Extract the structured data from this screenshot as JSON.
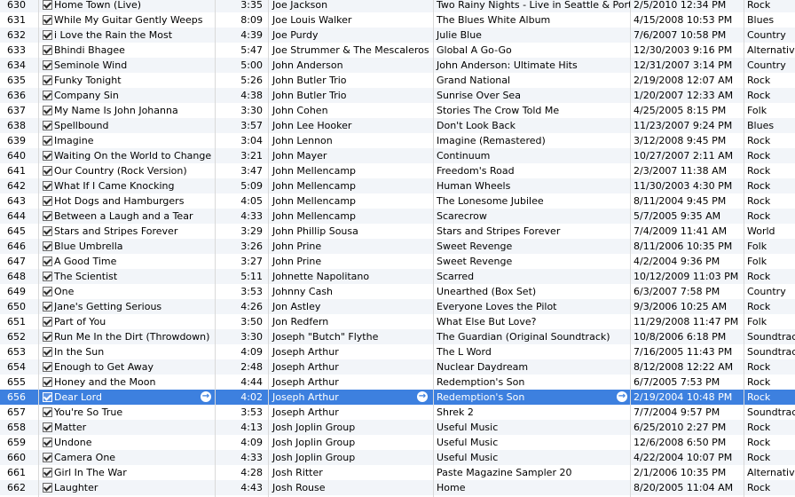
{
  "tracks": [
    {
      "num": "630",
      "name": "Home Town (Live)",
      "time": "3:35",
      "artist": "Joe Jackson",
      "album": "Two Rainy Nights - Live in Seattle & Portla...",
      "date_added": "2/5/2010 12:34 PM",
      "genre": "Rock"
    },
    {
      "num": "631",
      "name": "While My Guitar Gently Weeps",
      "time": "8:09",
      "artist": "Joe Louis Walker",
      "album": "The Blues White Album",
      "date_added": "4/15/2008 10:53 PM",
      "genre": "Blues"
    },
    {
      "num": "632",
      "name": "i Love the Rain the Most",
      "time": "4:39",
      "artist": "Joe Purdy",
      "album": "Julie Blue",
      "date_added": "7/6/2007 10:58 PM",
      "genre": "Country"
    },
    {
      "num": "633",
      "name": "Bhindi Bhagee",
      "time": "5:47",
      "artist": "Joe Strummer & The Mescaleros",
      "album": "Global A Go-Go",
      "date_added": "12/30/2003 9:16 PM",
      "genre": "Alternative"
    },
    {
      "num": "634",
      "name": "Seminole Wind",
      "time": "5:00",
      "artist": "John Anderson",
      "album": "John Anderson: Ultimate Hits",
      "date_added": "12/31/2007 3:14 PM",
      "genre": "Country"
    },
    {
      "num": "635",
      "name": "Funky Tonight",
      "time": "5:26",
      "artist": "John Butler Trio",
      "album": "Grand National",
      "date_added": "2/19/2008 12:07 AM",
      "genre": "Rock"
    },
    {
      "num": "636",
      "name": "Company Sin",
      "time": "4:38",
      "artist": "John Butler Trio",
      "album": "Sunrise Over Sea",
      "date_added": "1/20/2007 12:33 AM",
      "genre": "Rock"
    },
    {
      "num": "637",
      "name": "My Name Is John Johanna",
      "time": "3:30",
      "artist": "John Cohen",
      "album": "Stories The Crow Told Me",
      "date_added": "4/25/2005 8:15 PM",
      "genre": "Folk"
    },
    {
      "num": "638",
      "name": "Spellbound",
      "time": "3:57",
      "artist": "John Lee Hooker",
      "album": "Don't Look Back",
      "date_added": "11/23/2007 9:24 PM",
      "genre": "Blues"
    },
    {
      "num": "639",
      "name": "Imagine",
      "time": "3:04",
      "artist": "John Lennon",
      "album": "Imagine (Remastered)",
      "date_added": "3/12/2008 9:45 PM",
      "genre": "Rock"
    },
    {
      "num": "640",
      "name": "Waiting On the World to Change",
      "time": "3:21",
      "artist": "John Mayer",
      "album": "Continuum",
      "date_added": "10/27/2007 2:11 AM",
      "genre": "Rock"
    },
    {
      "num": "641",
      "name": "Our Country (Rock Version)",
      "time": "3:47",
      "artist": "John Mellencamp",
      "album": "Freedom's Road",
      "date_added": "2/3/2007 11:38 AM",
      "genre": "Rock"
    },
    {
      "num": "642",
      "name": "What If I Came Knocking",
      "time": "5:09",
      "artist": "John Mellencamp",
      "album": "Human Wheels",
      "date_added": "11/30/2003 4:30 PM",
      "genre": "Rock"
    },
    {
      "num": "643",
      "name": "Hot Dogs and Hamburgers",
      "time": "4:05",
      "artist": "John Mellencamp",
      "album": "The Lonesome Jubilee",
      "date_added": "8/11/2004 9:45 PM",
      "genre": "Rock"
    },
    {
      "num": "644",
      "name": "Between a Laugh and a Tear",
      "time": "4:33",
      "artist": "John Mellencamp",
      "album": "Scarecrow",
      "date_added": "5/7/2005 9:35 AM",
      "genre": "Rock"
    },
    {
      "num": "645",
      "name": "Stars and Stripes Forever",
      "time": "3:29",
      "artist": "John Phillip Sousa",
      "album": "Stars and Stripes Forever",
      "date_added": "7/4/2009 11:41 AM",
      "genre": "World"
    },
    {
      "num": "646",
      "name": "Blue Umbrella",
      "time": "3:26",
      "artist": "John Prine",
      "album": "Sweet Revenge",
      "date_added": "8/11/2006 10:35 PM",
      "genre": "Folk"
    },
    {
      "num": "647",
      "name": "A Good Time",
      "time": "3:27",
      "artist": "John Prine",
      "album": "Sweet Revenge",
      "date_added": "4/2/2004 9:36 PM",
      "genre": "Folk"
    },
    {
      "num": "648",
      "name": "The Scientist",
      "time": "5:11",
      "artist": "Johnette Napolitano",
      "album": "Scarred",
      "date_added": "10/12/2009 11:03 PM",
      "genre": "Rock"
    },
    {
      "num": "649",
      "name": "One",
      "time": "3:53",
      "artist": "Johnny Cash",
      "album": "Unearthed (Box Set)",
      "date_added": "6/3/2007 7:58 PM",
      "genre": "Country"
    },
    {
      "num": "650",
      "name": "Jane's Getting Serious",
      "time": "4:26",
      "artist": "Jon Astley",
      "album": "Everyone Loves the Pilot",
      "date_added": "9/3/2006 10:25 AM",
      "genre": "Rock"
    },
    {
      "num": "651",
      "name": "Part of You",
      "time": "3:50",
      "artist": "Jon Redfern",
      "album": "What Else But Love?",
      "date_added": "11/29/2008 11:47 PM",
      "genre": "Folk"
    },
    {
      "num": "652",
      "name": "Run Me In the Dirt (Throwdown)",
      "time": "3:30",
      "artist": "Joseph \"Butch\" Flythe",
      "album": "The Guardian (Original Soundtrack)",
      "date_added": "10/8/2006 6:18 PM",
      "genre": "Soundtrack"
    },
    {
      "num": "653",
      "name": "In the Sun",
      "time": "4:09",
      "artist": "Joseph Arthur",
      "album": "The L Word",
      "date_added": "7/16/2005 11:43 PM",
      "genre": "Soundtrack"
    },
    {
      "num": "654",
      "name": "Enough to Get Away",
      "time": "2:48",
      "artist": "Joseph Arthur",
      "album": "Nuclear Daydream",
      "date_added": "8/12/2008 12:22 AM",
      "genre": "Rock"
    },
    {
      "num": "655",
      "name": "Honey and the Moon",
      "time": "4:44",
      "artist": "Joseph Arthur",
      "album": "Redemption's Son",
      "date_added": "6/7/2005 7:53 PM",
      "genre": "Rock"
    },
    {
      "num": "656",
      "name": "Dear Lord",
      "time": "4:02",
      "artist": "Joseph Arthur",
      "album": "Redemption's Son",
      "date_added": "2/19/2004 10:48 PM",
      "genre": "Rock",
      "selected": true
    },
    {
      "num": "657",
      "name": "You're So True",
      "time": "3:53",
      "artist": "Joseph Arthur",
      "album": "Shrek 2",
      "date_added": "7/7/2004 9:57 PM",
      "genre": "Soundtrack"
    },
    {
      "num": "658",
      "name": "Matter",
      "time": "4:13",
      "artist": "Josh Joplin Group",
      "album": "Useful Music",
      "date_added": "6/25/2010 2:27 PM",
      "genre": "Rock"
    },
    {
      "num": "659",
      "name": "Undone",
      "time": "4:09",
      "artist": "Josh Joplin Group",
      "album": "Useful Music",
      "date_added": "12/6/2008 6:50 PM",
      "genre": "Rock"
    },
    {
      "num": "660",
      "name": "Camera One",
      "time": "4:33",
      "artist": "Josh Joplin Group",
      "album": "Useful Music",
      "date_added": "4/22/2004 10:07 PM",
      "genre": "Rock"
    },
    {
      "num": "661",
      "name": "Girl In The War",
      "time": "4:28",
      "artist": "Josh Ritter",
      "album": "Paste Magazine Sampler 20",
      "date_added": "2/1/2006 10:35 PM",
      "genre": "Alternative"
    },
    {
      "num": "662",
      "name": "Laughter",
      "time": "4:43",
      "artist": "Josh Rouse",
      "album": "Home",
      "date_added": "8/20/2005 11:04 AM",
      "genre": "Rock"
    }
  ],
  "colors": {
    "selection": "#3d80df",
    "stripe": "#f2f5f9",
    "grid_line": "#d9d9d9"
  }
}
